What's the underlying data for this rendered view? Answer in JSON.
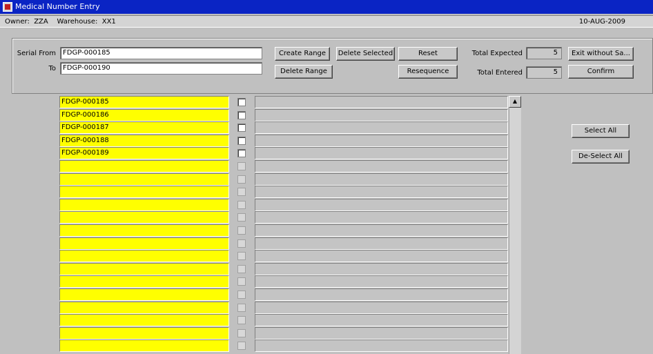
{
  "window": {
    "title": "Medical Number Entry",
    "icon": "oracle-forms-icon"
  },
  "info": {
    "owner": "Owner:  ZZA    Warehouse:  XX1",
    "date": "10-AUG-2009"
  },
  "form": {
    "serial_from_label": "Serial From",
    "serial_from_value": "FDGP-000185",
    "to_label": "To",
    "to_value": "FDGP-000190",
    "total_expected_label": "Total Expected",
    "total_expected_value": "5",
    "total_entered_label": "Total Entered",
    "total_entered_value": "5"
  },
  "buttons": {
    "create_range": "Create Range",
    "delete_selected": "Delete Selected",
    "reset": "Reset",
    "exit_without_save": "Exit without Sa...",
    "delete_range": "Delete Range",
    "resequence": "Resequence",
    "confirm": "Confirm",
    "select_all": "Select All",
    "deselect_all": "De-Select All"
  },
  "rows": [
    {
      "serial": "FDGP-000185",
      "checked": false,
      "enabled": true
    },
    {
      "serial": "FDGP-000186",
      "checked": false,
      "enabled": true
    },
    {
      "serial": "FDGP-000187",
      "checked": false,
      "enabled": true
    },
    {
      "serial": "FDGP-000188",
      "checked": false,
      "enabled": true
    },
    {
      "serial": "FDGP-000189",
      "checked": false,
      "enabled": true
    },
    {
      "serial": "",
      "checked": false,
      "enabled": false
    },
    {
      "serial": "",
      "checked": false,
      "enabled": false
    },
    {
      "serial": "",
      "checked": false,
      "enabled": false
    },
    {
      "serial": "",
      "checked": false,
      "enabled": false
    },
    {
      "serial": "",
      "checked": false,
      "enabled": false
    },
    {
      "serial": "",
      "checked": false,
      "enabled": false
    },
    {
      "serial": "",
      "checked": false,
      "enabled": false
    },
    {
      "serial": "",
      "checked": false,
      "enabled": false
    },
    {
      "serial": "",
      "checked": false,
      "enabled": false
    },
    {
      "serial": "",
      "checked": false,
      "enabled": false
    },
    {
      "serial": "",
      "checked": false,
      "enabled": false
    },
    {
      "serial": "",
      "checked": false,
      "enabled": false
    },
    {
      "serial": "",
      "checked": false,
      "enabled": false
    },
    {
      "serial": "",
      "checked": false,
      "enabled": false
    },
    {
      "serial": "",
      "checked": false,
      "enabled": false
    }
  ],
  "colors": {
    "titlebar": "#0a24c4",
    "serial_field": "#ffff00",
    "background": "#c0c0c0"
  }
}
